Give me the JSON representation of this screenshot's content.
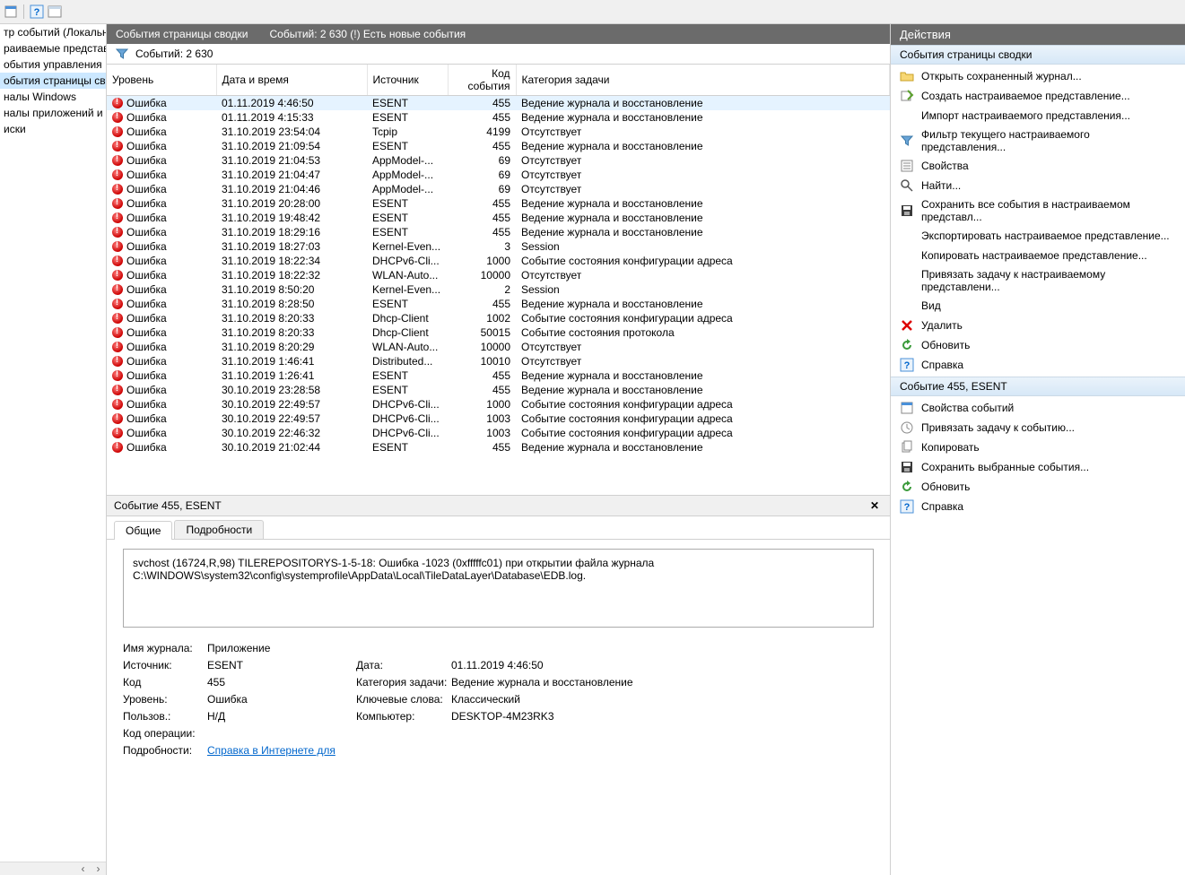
{
  "toolbar_icons": [
    "file-icon",
    "help-icon",
    "window-icon"
  ],
  "tree": {
    "items": [
      {
        "label": "тр событий (Локальны",
        "selected": false
      },
      {
        "label": "раиваемые представл",
        "selected": false
      },
      {
        "label": "обытия управления",
        "selected": false
      },
      {
        "label": "обытия страницы сво",
        "selected": true
      },
      {
        "label": "налы Windows",
        "selected": false
      },
      {
        "label": "налы приложений и сл",
        "selected": false
      },
      {
        "label": "иски",
        "selected": false
      }
    ]
  },
  "center": {
    "title": "События страницы сводки",
    "subtitle": "Событий: 2 630 (!) Есть новые события",
    "filter_label": "Событий: 2 630",
    "columns": {
      "level": "Уровень",
      "date": "Дата и время",
      "source": "Источник",
      "code": "Код события",
      "task": "Категория задачи"
    },
    "rows": [
      {
        "level": "Ошибка",
        "date": "01.11.2019 4:46:50",
        "source": "ESENT",
        "code": "455",
        "task": "Ведение журнала и восстановление",
        "selected": true
      },
      {
        "level": "Ошибка",
        "date": "01.11.2019 4:15:33",
        "source": "ESENT",
        "code": "455",
        "task": "Ведение журнала и восстановление"
      },
      {
        "level": "Ошибка",
        "date": "31.10.2019 23:54:04",
        "source": "Tcpip",
        "code": "4199",
        "task": "Отсутствует"
      },
      {
        "level": "Ошибка",
        "date": "31.10.2019 21:09:54",
        "source": "ESENT",
        "code": "455",
        "task": "Ведение журнала и восстановление"
      },
      {
        "level": "Ошибка",
        "date": "31.10.2019 21:04:53",
        "source": "AppModel-...",
        "code": "69",
        "task": "Отсутствует"
      },
      {
        "level": "Ошибка",
        "date": "31.10.2019 21:04:47",
        "source": "AppModel-...",
        "code": "69",
        "task": "Отсутствует"
      },
      {
        "level": "Ошибка",
        "date": "31.10.2019 21:04:46",
        "source": "AppModel-...",
        "code": "69",
        "task": "Отсутствует"
      },
      {
        "level": "Ошибка",
        "date": "31.10.2019 20:28:00",
        "source": "ESENT",
        "code": "455",
        "task": "Ведение журнала и восстановление"
      },
      {
        "level": "Ошибка",
        "date": "31.10.2019 19:48:42",
        "source": "ESENT",
        "code": "455",
        "task": "Ведение журнала и восстановление"
      },
      {
        "level": "Ошибка",
        "date": "31.10.2019 18:29:16",
        "source": "ESENT",
        "code": "455",
        "task": "Ведение журнала и восстановление"
      },
      {
        "level": "Ошибка",
        "date": "31.10.2019 18:27:03",
        "source": "Kernel-Even...",
        "code": "3",
        "task": "Session"
      },
      {
        "level": "Ошибка",
        "date": "31.10.2019 18:22:34",
        "source": "DHCPv6-Cli...",
        "code": "1000",
        "task": "Событие состояния конфигурации адреса"
      },
      {
        "level": "Ошибка",
        "date": "31.10.2019 18:22:32",
        "source": "WLAN-Auto...",
        "code": "10000",
        "task": "Отсутствует"
      },
      {
        "level": "Ошибка",
        "date": "31.10.2019 8:50:20",
        "source": "Kernel-Even...",
        "code": "2",
        "task": "Session"
      },
      {
        "level": "Ошибка",
        "date": "31.10.2019 8:28:50",
        "source": "ESENT",
        "code": "455",
        "task": "Ведение журнала и восстановление"
      },
      {
        "level": "Ошибка",
        "date": "31.10.2019 8:20:33",
        "source": "Dhcp-Client",
        "code": "1002",
        "task": "Событие состояния конфигурации адреса"
      },
      {
        "level": "Ошибка",
        "date": "31.10.2019 8:20:33",
        "source": "Dhcp-Client",
        "code": "50015",
        "task": "Событие состояния протокола"
      },
      {
        "level": "Ошибка",
        "date": "31.10.2019 8:20:29",
        "source": "WLAN-Auto...",
        "code": "10000",
        "task": "Отсутствует"
      },
      {
        "level": "Ошибка",
        "date": "31.10.2019 1:46:41",
        "source": "Distributed...",
        "code": "10010",
        "task": "Отсутствует"
      },
      {
        "level": "Ошибка",
        "date": "31.10.2019 1:26:41",
        "source": "ESENT",
        "code": "455",
        "task": "Ведение журнала и восстановление"
      },
      {
        "level": "Ошибка",
        "date": "30.10.2019 23:28:58",
        "source": "ESENT",
        "code": "455",
        "task": "Ведение журнала и восстановление"
      },
      {
        "level": "Ошибка",
        "date": "30.10.2019 22:49:57",
        "source": "DHCPv6-Cli...",
        "code": "1000",
        "task": "Событие состояния конфигурации адреса"
      },
      {
        "level": "Ошибка",
        "date": "30.10.2019 22:49:57",
        "source": "DHCPv6-Cli...",
        "code": "1003",
        "task": "Событие состояния конфигурации адреса"
      },
      {
        "level": "Ошибка",
        "date": "30.10.2019 22:46:32",
        "source": "DHCPv6-Cli...",
        "code": "1003",
        "task": "Событие состояния конфигурации адреса"
      },
      {
        "level": "Ошибка",
        "date": "30.10.2019 21:02:44",
        "source": "ESENT",
        "code": "455",
        "task": "Ведение журнала и восстановление"
      }
    ]
  },
  "detail": {
    "title": "Событие 455, ESENT",
    "tabs": {
      "general": "Общие",
      "details": "Подробности"
    },
    "message": "svchost (16724,R,98) TILEREPOSITORYS-1-5-18: Ошибка -1023 (0xfffffc01) при открытии файла журнала C:\\WINDOWS\\system32\\config\\systemprofile\\AppData\\Local\\TileDataLayer\\Database\\EDB.log.",
    "fields": {
      "log_name_lbl": "Имя журнала:",
      "log_name": "Приложение",
      "source_lbl": "Источник:",
      "source": "ESENT",
      "date_lbl": "Дата:",
      "date": "01.11.2019 4:46:50",
      "code_lbl": "Код",
      "code": "455",
      "task_lbl": "Категория задачи:",
      "task": "Ведение журнала и восстановление",
      "level_lbl": "Уровень:",
      "level": "Ошибка",
      "keywords_lbl": "Ключевые слова:",
      "keywords": "Классический",
      "user_lbl": "Пользов.:",
      "user": "Н/Д",
      "computer_lbl": "Компьютер:",
      "computer": "DESKTOP-4M23RK3",
      "opcode_lbl": "Код операции:",
      "opcode": "",
      "more_lbl": "Подробности:",
      "more_link": "Справка в Интернете для "
    }
  },
  "actions": {
    "title": "Действия",
    "section1": "События страницы сводки",
    "list1": [
      {
        "icon": "folder-icon",
        "label": "Открыть сохраненный журнал..."
      },
      {
        "icon": "create-view-icon",
        "label": "Создать настраиваемое представление..."
      },
      {
        "icon": "blank",
        "label": "Импорт настраиваемого представления..."
      },
      {
        "icon": "filter-icon",
        "label": "Фильтр текущего настраиваемого представления..."
      },
      {
        "icon": "properties-icon",
        "label": "Свойства"
      },
      {
        "icon": "find-icon",
        "label": "Найти..."
      },
      {
        "icon": "save-icon",
        "label": "Сохранить все события в настраиваемом представл..."
      },
      {
        "icon": "blank",
        "label": "Экспортировать настраиваемое представление..."
      },
      {
        "icon": "blank",
        "label": "Копировать настраиваемое представление..."
      },
      {
        "icon": "blank",
        "label": "Привязать задачу к настраиваемому представлени..."
      },
      {
        "icon": "blank",
        "label": "Вид"
      },
      {
        "icon": "delete-icon",
        "label": "Удалить"
      },
      {
        "icon": "refresh-icon",
        "label": "Обновить"
      },
      {
        "icon": "help-action-icon",
        "label": "Справка"
      }
    ],
    "section2": "Событие 455, ESENT",
    "list2": [
      {
        "icon": "event-props-icon",
        "label": "Свойства событий"
      },
      {
        "icon": "attach-task-icon",
        "label": "Привязать задачу к событию..."
      },
      {
        "icon": "copy-icon",
        "label": "Копировать"
      },
      {
        "icon": "save-icon",
        "label": "Сохранить выбранные события..."
      },
      {
        "icon": "refresh-icon",
        "label": "Обновить"
      },
      {
        "icon": "help-action-icon",
        "label": "Справка"
      }
    ]
  }
}
